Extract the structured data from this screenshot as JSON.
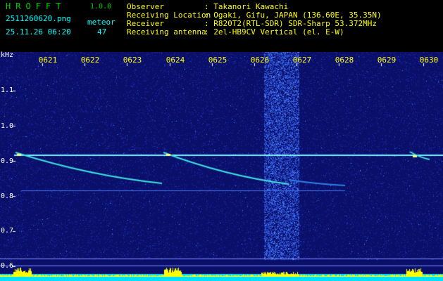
{
  "header": {
    "app_title": "HROFFT",
    "app_version": "1.0.0",
    "file_name": "2511260620.png",
    "date_time": "25.11.26 06:20",
    "count_label": "meteor",
    "count_value": "47",
    "info": [
      {
        "key": "Observer",
        "value": ": Takanori Kawachi"
      },
      {
        "key": "Receiving Location",
        "value": ": Ogaki, Gifu, JAPAN (136.60E, 35.35N)"
      },
      {
        "key": "Receiver",
        "value": ": R820T2(RTL-SDR) SDR-Sharp 53.372MHz"
      },
      {
        "key": "Receiving antenna",
        "value": ": 2el-HB9CV Vertical (el. E-W)"
      }
    ]
  },
  "axis": {
    "unit": "kHz",
    "time_ticks": [
      "0621",
      "0622",
      "0623",
      "0624",
      "0625",
      "0626",
      "0627",
      "0628",
      "0629",
      "0630"
    ],
    "freq_ticks": [
      "1.1",
      "1.0",
      "0.9",
      "0.8",
      "0.7",
      "0.6"
    ]
  },
  "colors": {
    "background": "#0a0f6a",
    "carrier": "#7ff0ff",
    "trail": "#40e0e0",
    "header_green": "#00d000",
    "header_cyan": "#00ffff",
    "header_yellow": "#ffff00",
    "meter_yellow": "#ffff00",
    "meter_cyan": "#00e0ff"
  }
}
